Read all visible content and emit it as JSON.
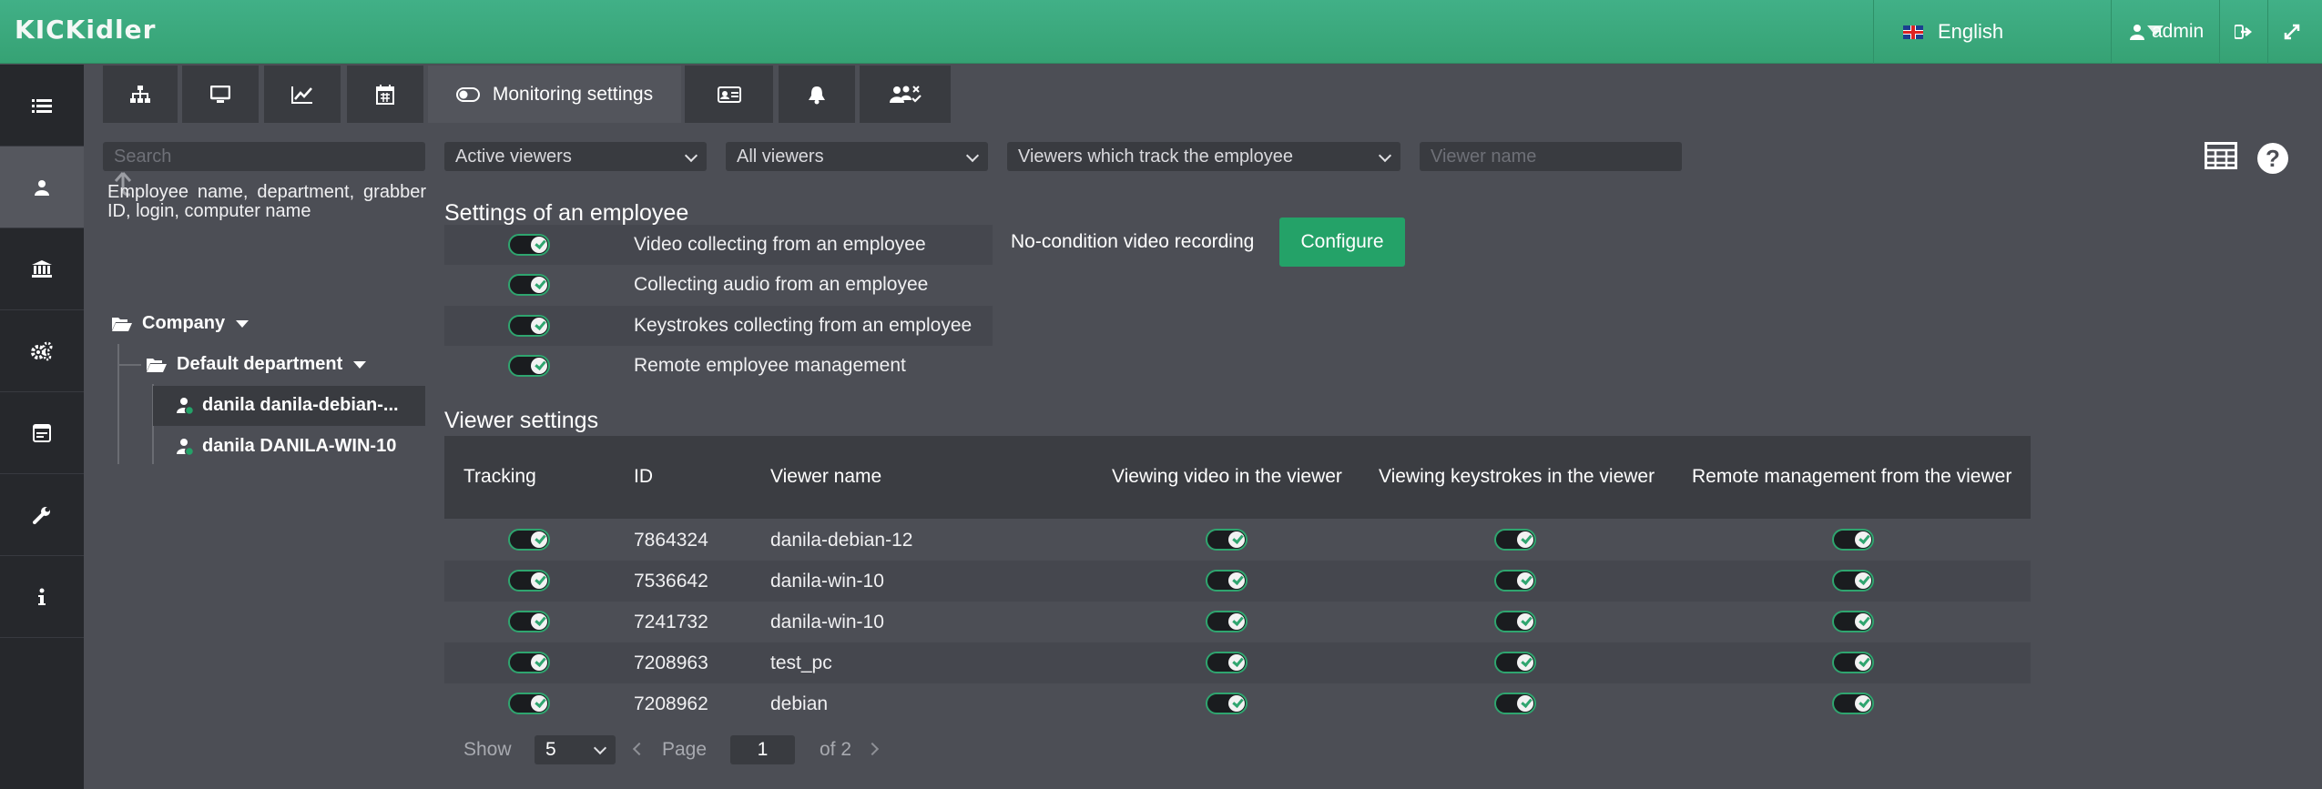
{
  "header": {
    "logo": "KICKidler",
    "language": "English",
    "user": "admin",
    "icons": [
      "logout-icon",
      "expand-icon"
    ]
  },
  "sidebar": {
    "items": [
      {
        "name": "list-icon",
        "active": false
      },
      {
        "name": "employee-icon",
        "active": true
      },
      {
        "name": "institution-icon",
        "active": false
      },
      {
        "name": "cogs-icon",
        "active": false
      },
      {
        "name": "calendar-window-icon",
        "active": false
      },
      {
        "name": "wrench-icon",
        "active": false
      },
      {
        "name": "info-icon",
        "active": false
      }
    ]
  },
  "tabs": [
    {
      "icon": "sitemap-icon"
    },
    {
      "icon": "monitor-icon"
    },
    {
      "icon": "chart-icon"
    },
    {
      "icon": "calendar-icon"
    },
    {
      "icon": "toggle-icon",
      "label": "Monitoring settings",
      "active": true
    },
    {
      "icon": "id-card-icon"
    },
    {
      "icon": "bell-icon"
    },
    {
      "icon": "users-check-icon"
    }
  ],
  "filters": {
    "search_placeholder": "Search",
    "active_viewers": "Active viewers",
    "all_viewers": "All viewers",
    "tracking_filter": "Viewers which track the employee",
    "viewer_name_placeholder": "Viewer name"
  },
  "search_hint": "Employee name, department, grabber ID, login, computer name",
  "tree": {
    "company": "Company",
    "department": "Default department",
    "employees": [
      "danila danila-debian-...",
      "danila DANILA-WIN-10"
    ]
  },
  "employee_settings": {
    "title": "Settings of an employee",
    "rows": [
      {
        "label": "Video collecting from an employee",
        "enabled": true
      },
      {
        "label": "Collecting audio from an employee",
        "enabled": true
      },
      {
        "label": "Keystrokes collecting from an employee",
        "enabled": true
      },
      {
        "label": "Remote employee management",
        "enabled": true
      }
    ],
    "video_mode": "No-condition video recording",
    "configure_label": "Configure"
  },
  "viewer_settings": {
    "title": "Viewer settings",
    "columns": [
      "Tracking",
      "ID",
      "Viewer name",
      "Viewing video in the viewer",
      "Viewing keystrokes in the viewer",
      "Remote management from the viewer"
    ],
    "rows": [
      {
        "id": "7864324",
        "name": "danila-debian-12"
      },
      {
        "id": "7536642",
        "name": "danila-win-10"
      },
      {
        "id": "7241732",
        "name": "danila-win-10"
      },
      {
        "id": "7208963",
        "name": "test_pc"
      },
      {
        "id": "7208962",
        "name": "debian"
      }
    ]
  },
  "pagination": {
    "show_label": "Show",
    "page_size": "5",
    "page_label": "Page",
    "page": "1",
    "of_label": "of 2"
  },
  "colors": {
    "accent": "#24a268",
    "header": "#3aa87c",
    "background": "#4c4e55",
    "sidebar": "#26282c"
  }
}
